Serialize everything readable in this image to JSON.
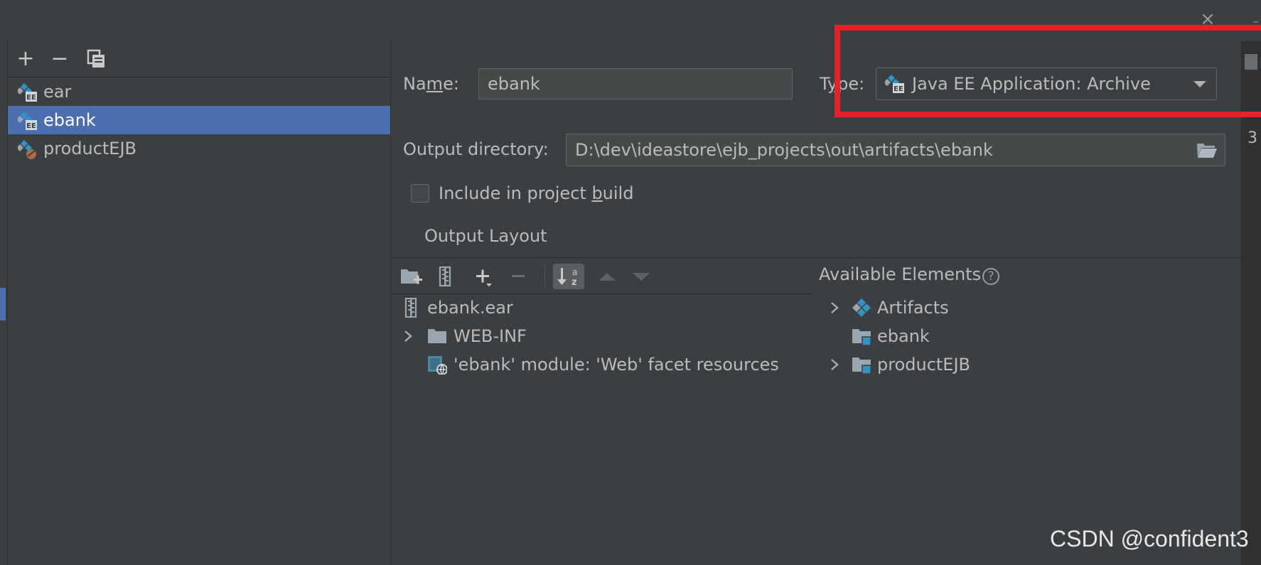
{
  "window": {
    "close_glyph": "×"
  },
  "artifacts_toolbar": {
    "add_glyph": "+",
    "remove_glyph": "−"
  },
  "artifacts": [
    {
      "label": "ear",
      "icon": "javaee-artifact-icon",
      "selected": false
    },
    {
      "label": "ebank",
      "icon": "javaee-artifact-icon",
      "selected": true
    },
    {
      "label": "productEJB",
      "icon": "ejb-artifact-icon",
      "selected": false
    }
  ],
  "form": {
    "name_label_pre": "Na",
    "name_label_mn": "m",
    "name_label_post": "e:",
    "name_value": "ebank",
    "type_label_pre": "T",
    "type_label_y": "y",
    "type_label_post": "pe:",
    "type_value": "Java EE Application: Archive",
    "output_dir_label": "Output directory:",
    "output_dir_value": "D:\\dev\\ideastore\\ejb_projects\\out\\artifacts\\ebank",
    "include_label_pre": "Include in project ",
    "include_label_b": "b",
    "include_label_post": "uild",
    "include_checked": false
  },
  "layout_tab": {
    "title": "Output Layout"
  },
  "layout_tree": [
    {
      "label": "ebank.ear",
      "icon": "archive-icon",
      "expandable": false
    },
    {
      "label": "WEB-INF",
      "icon": "folder-icon",
      "expandable": true
    },
    {
      "label": "'ebank' module: 'Web' facet resources",
      "icon": "web-facet-icon",
      "expandable": false
    }
  ],
  "available": {
    "title": "Available Elements",
    "help_glyph": "?",
    "items": [
      {
        "label": "Artifacts",
        "icon": "artifacts-icon",
        "expandable": true
      },
      {
        "label": "ebank",
        "icon": "module-folder-icon",
        "expandable": false
      },
      {
        "label": "productEJB",
        "icon": "module-folder-icon",
        "expandable": true
      }
    ]
  },
  "edge": {
    "number": "3"
  },
  "watermark": "CSDN @confident3",
  "colors": {
    "background": "#3c3f41",
    "selection": "#4b6eaf",
    "highlight_box": "#e5212b",
    "icon_blue": "#3592c4"
  }
}
